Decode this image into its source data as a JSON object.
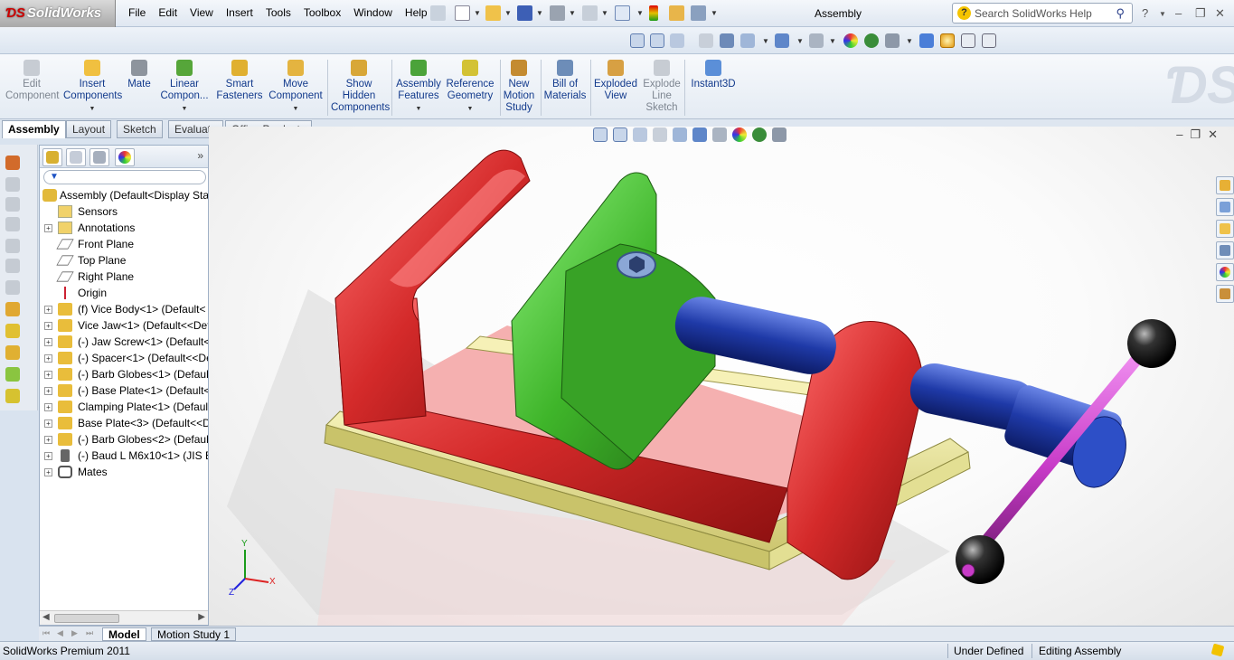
{
  "app": {
    "logo_text": "SolidWorks",
    "document_title": "Assembly",
    "search_placeholder": "Search SolidWorks Help"
  },
  "menu": [
    "File",
    "Edit",
    "View",
    "Insert",
    "Tools",
    "Toolbox",
    "Window",
    "Help"
  ],
  "commands": [
    {
      "label": "Edit\nComponent",
      "icon": "edit-component-icon",
      "enabled": false
    },
    {
      "label": "Insert\nComponents",
      "icon": "insert-components-icon",
      "enabled": true,
      "dropdown": true
    },
    {
      "label": "Mate",
      "icon": "mate-icon",
      "enabled": true
    },
    {
      "label": "Linear\nCompon...",
      "icon": "linear-pattern-icon",
      "enabled": true,
      "dropdown": true
    },
    {
      "label": "Smart\nFasteners",
      "icon": "smart-fasteners-icon",
      "enabled": true
    },
    {
      "label": "Move\nComponent",
      "icon": "move-component-icon",
      "enabled": true,
      "dropdown": true
    },
    {
      "label": "Show\nHidden\nComponents",
      "icon": "show-hidden-icon",
      "enabled": true
    },
    {
      "label": "Assembly\nFeatures",
      "icon": "assembly-features-icon",
      "enabled": true,
      "dropdown": true
    },
    {
      "label": "Reference\nGeometry",
      "icon": "reference-geometry-icon",
      "enabled": true,
      "dropdown": true
    },
    {
      "label": "New\nMotion\nStudy",
      "icon": "motion-study-icon",
      "enabled": true
    },
    {
      "label": "Bill of\nMaterials",
      "icon": "bill-of-materials-icon",
      "enabled": true
    },
    {
      "label": "Exploded\nView",
      "icon": "exploded-view-icon",
      "enabled": true
    },
    {
      "label": "Explode\nLine\nSketch",
      "icon": "explode-line-sketch-icon",
      "enabled": false
    },
    {
      "label": "Instant3D",
      "icon": "instant3d-icon",
      "enabled": true
    }
  ],
  "cm_tabs": [
    "Assembly",
    "Layout",
    "Sketch",
    "Evaluate",
    "Office Products"
  ],
  "tree": {
    "root": "Assembly  (Default<Display Sta",
    "items": [
      {
        "label": "Sensors",
        "icon": "sensors-icon",
        "expandable": false
      },
      {
        "label": "Annotations",
        "icon": "annotations-icon",
        "expandable": true
      },
      {
        "label": "Front Plane",
        "icon": "plane-icon",
        "expandable": false
      },
      {
        "label": "Top Plane",
        "icon": "plane-icon",
        "expandable": false
      },
      {
        "label": "Right Plane",
        "icon": "plane-icon",
        "expandable": false
      },
      {
        "label": "Origin",
        "icon": "origin-icon",
        "expandable": false
      },
      {
        "label": "(f) Vice Body<1> (Default<",
        "icon": "part-icon",
        "expandable": true
      },
      {
        "label": "Vice Jaw<1> (Default<<Def",
        "icon": "part-icon",
        "expandable": true
      },
      {
        "label": "(-) Jaw Screw<1> (Default<",
        "icon": "part-icon",
        "expandable": true
      },
      {
        "label": "(-) Spacer<1> (Default<<De",
        "icon": "part-icon",
        "expandable": true
      },
      {
        "label": "(-) Barb Globes<1> (Default",
        "icon": "part-icon",
        "expandable": true
      },
      {
        "label": "(-) Base Plate<1> (Default<",
        "icon": "part-icon",
        "expandable": true
      },
      {
        "label": "Clamping Plate<1> (Defaul",
        "icon": "part-icon",
        "expandable": true
      },
      {
        "label": "Base Plate<3> (Default<<D",
        "icon": "part-icon",
        "expandable": true
      },
      {
        "label": "(-) Barb Globes<2> (Default",
        "icon": "part-icon",
        "expandable": true
      },
      {
        "label": "(-) Baud L M6x10<1> (JIS B",
        "icon": "toolbox-part-icon",
        "expandable": true
      },
      {
        "label": "Mates",
        "icon": "mates-icon",
        "expandable": true
      }
    ]
  },
  "bottom_tabs": [
    "Model",
    "Motion Study 1"
  ],
  "status": {
    "app": "SolidWorks Premium 2011",
    "definition": "Under Defined",
    "mode": "Editing Assembly"
  },
  "triad": {
    "x": "X",
    "y": "Y",
    "z": "Z"
  },
  "colors": {
    "vice_body": "#d42a2a",
    "vice_jaw": "#3fb52a",
    "screw": "#1f3aa8",
    "handle": "#c83bc8",
    "base_plate": "#e6e29a",
    "globes": "#222222"
  }
}
